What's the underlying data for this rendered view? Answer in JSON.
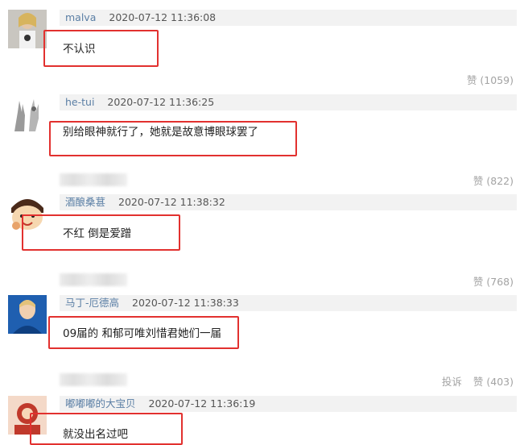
{
  "comments": [
    {
      "username": "malva",
      "timestamp": "2020-07-12 11:36:08",
      "text": "不认识",
      "likes_label": "赞 (1059)",
      "report_label": ""
    },
    {
      "username": "he-tui",
      "timestamp": "2020-07-12 11:36:25",
      "text": "别给眼神就行了，她就是故意博眼球罢了",
      "likes_label": "赞 (822)",
      "report_label": ""
    },
    {
      "username": "酒酿桑葚",
      "timestamp": "2020-07-12 11:38:32",
      "text": "不红 倒是爱蹭",
      "likes_label": "赞 (768)",
      "report_label": ""
    },
    {
      "username": "马丁-厄德高",
      "timestamp": "2020-07-12 11:38:33",
      "text": "09届的 和郁可唯刘惜君她们一届",
      "likes_label": "赞 (403)",
      "report_label": "投诉"
    },
    {
      "username": "嘟嘟嘟的大宝贝",
      "timestamp": "2020-07-12 11:36:19",
      "text": "就没出名过吧",
      "likes_label": "",
      "report_label": ""
    }
  ],
  "colors": {
    "highlight_box": "#e2312f",
    "username": "#5b7fa5",
    "meta_bg": "#f2f2f2",
    "footer_text": "#a3a3a3"
  }
}
